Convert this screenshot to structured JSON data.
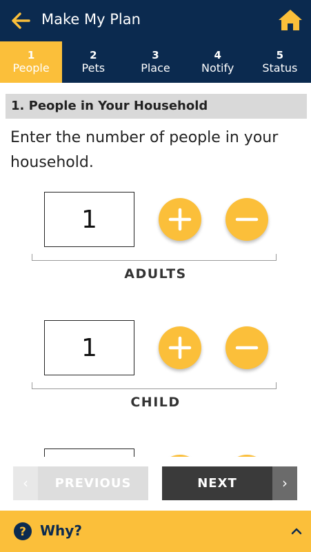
{
  "header": {
    "title": "Make My Plan",
    "back_icon": "arrow-left-icon",
    "home_icon": "home-icon"
  },
  "steps": [
    {
      "num": "1",
      "label": "People",
      "active": true
    },
    {
      "num": "2",
      "label": "Pets",
      "active": false
    },
    {
      "num": "3",
      "label": "Place",
      "active": false
    },
    {
      "num": "4",
      "label": "Notify",
      "active": false
    },
    {
      "num": "5",
      "label": "Status",
      "active": false
    }
  ],
  "section": {
    "title": "1. People in Your Household",
    "prompt": "Enter the number of people in your household."
  },
  "counters": [
    {
      "label": "ADULTS",
      "value": "1"
    },
    {
      "label": "CHILD",
      "value": "1"
    },
    {
      "label": "",
      "value": ""
    }
  ],
  "nav": {
    "previous_label": "PREVIOUS",
    "next_label": "NEXT",
    "prev_arrow": "‹",
    "next_arrow": "›"
  },
  "why": {
    "label": "Why?",
    "icon": "question-circle-icon",
    "chevron": "chevron-up-icon"
  },
  "colors": {
    "navy": "#0b2a4f",
    "accent": "#fbbf3a"
  }
}
